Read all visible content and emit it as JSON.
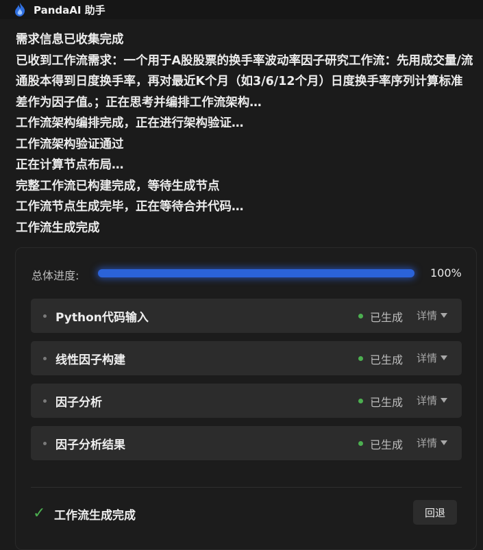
{
  "header": {
    "app_title": "PandaAI 助手",
    "logo_icon": "flame-logo-icon"
  },
  "messages": [
    "需求信息已收集完成",
    "已收到工作流需求：一个用于A股股票的换手率波动率因子研究工作流：先用成交量/流通股本得到日度换手率，再对最近K个月（如3/6/12个月）日度换手率序列计算标准差作为因子值。；正在思考并编排工作流架构…",
    "工作流架构编排完成，正在进行架构验证…",
    "工作流架构验证通过",
    "正在计算节点布局…",
    "完整工作流已构建完成，等待生成节点",
    "工作流节点生成完毕，正在等待合并代码…",
    "工作流生成完成"
  ],
  "progress": {
    "label": "总体进度:",
    "value_text": "100%",
    "fraction": 1.0
  },
  "nodes": [
    {
      "name": "Python代码输入",
      "status": "已生成",
      "detail": "详情"
    },
    {
      "name": "线性因子构建",
      "status": "已生成",
      "detail": "详情"
    },
    {
      "name": "因子分析",
      "status": "已生成",
      "detail": "详情"
    },
    {
      "name": "因子分析结果",
      "status": "已生成",
      "detail": "详情"
    }
  ],
  "footer": {
    "done_text": "工作流生成完成",
    "back_label": "回退"
  },
  "colors": {
    "accent": "#2b63d9",
    "success": "#4caf50"
  }
}
